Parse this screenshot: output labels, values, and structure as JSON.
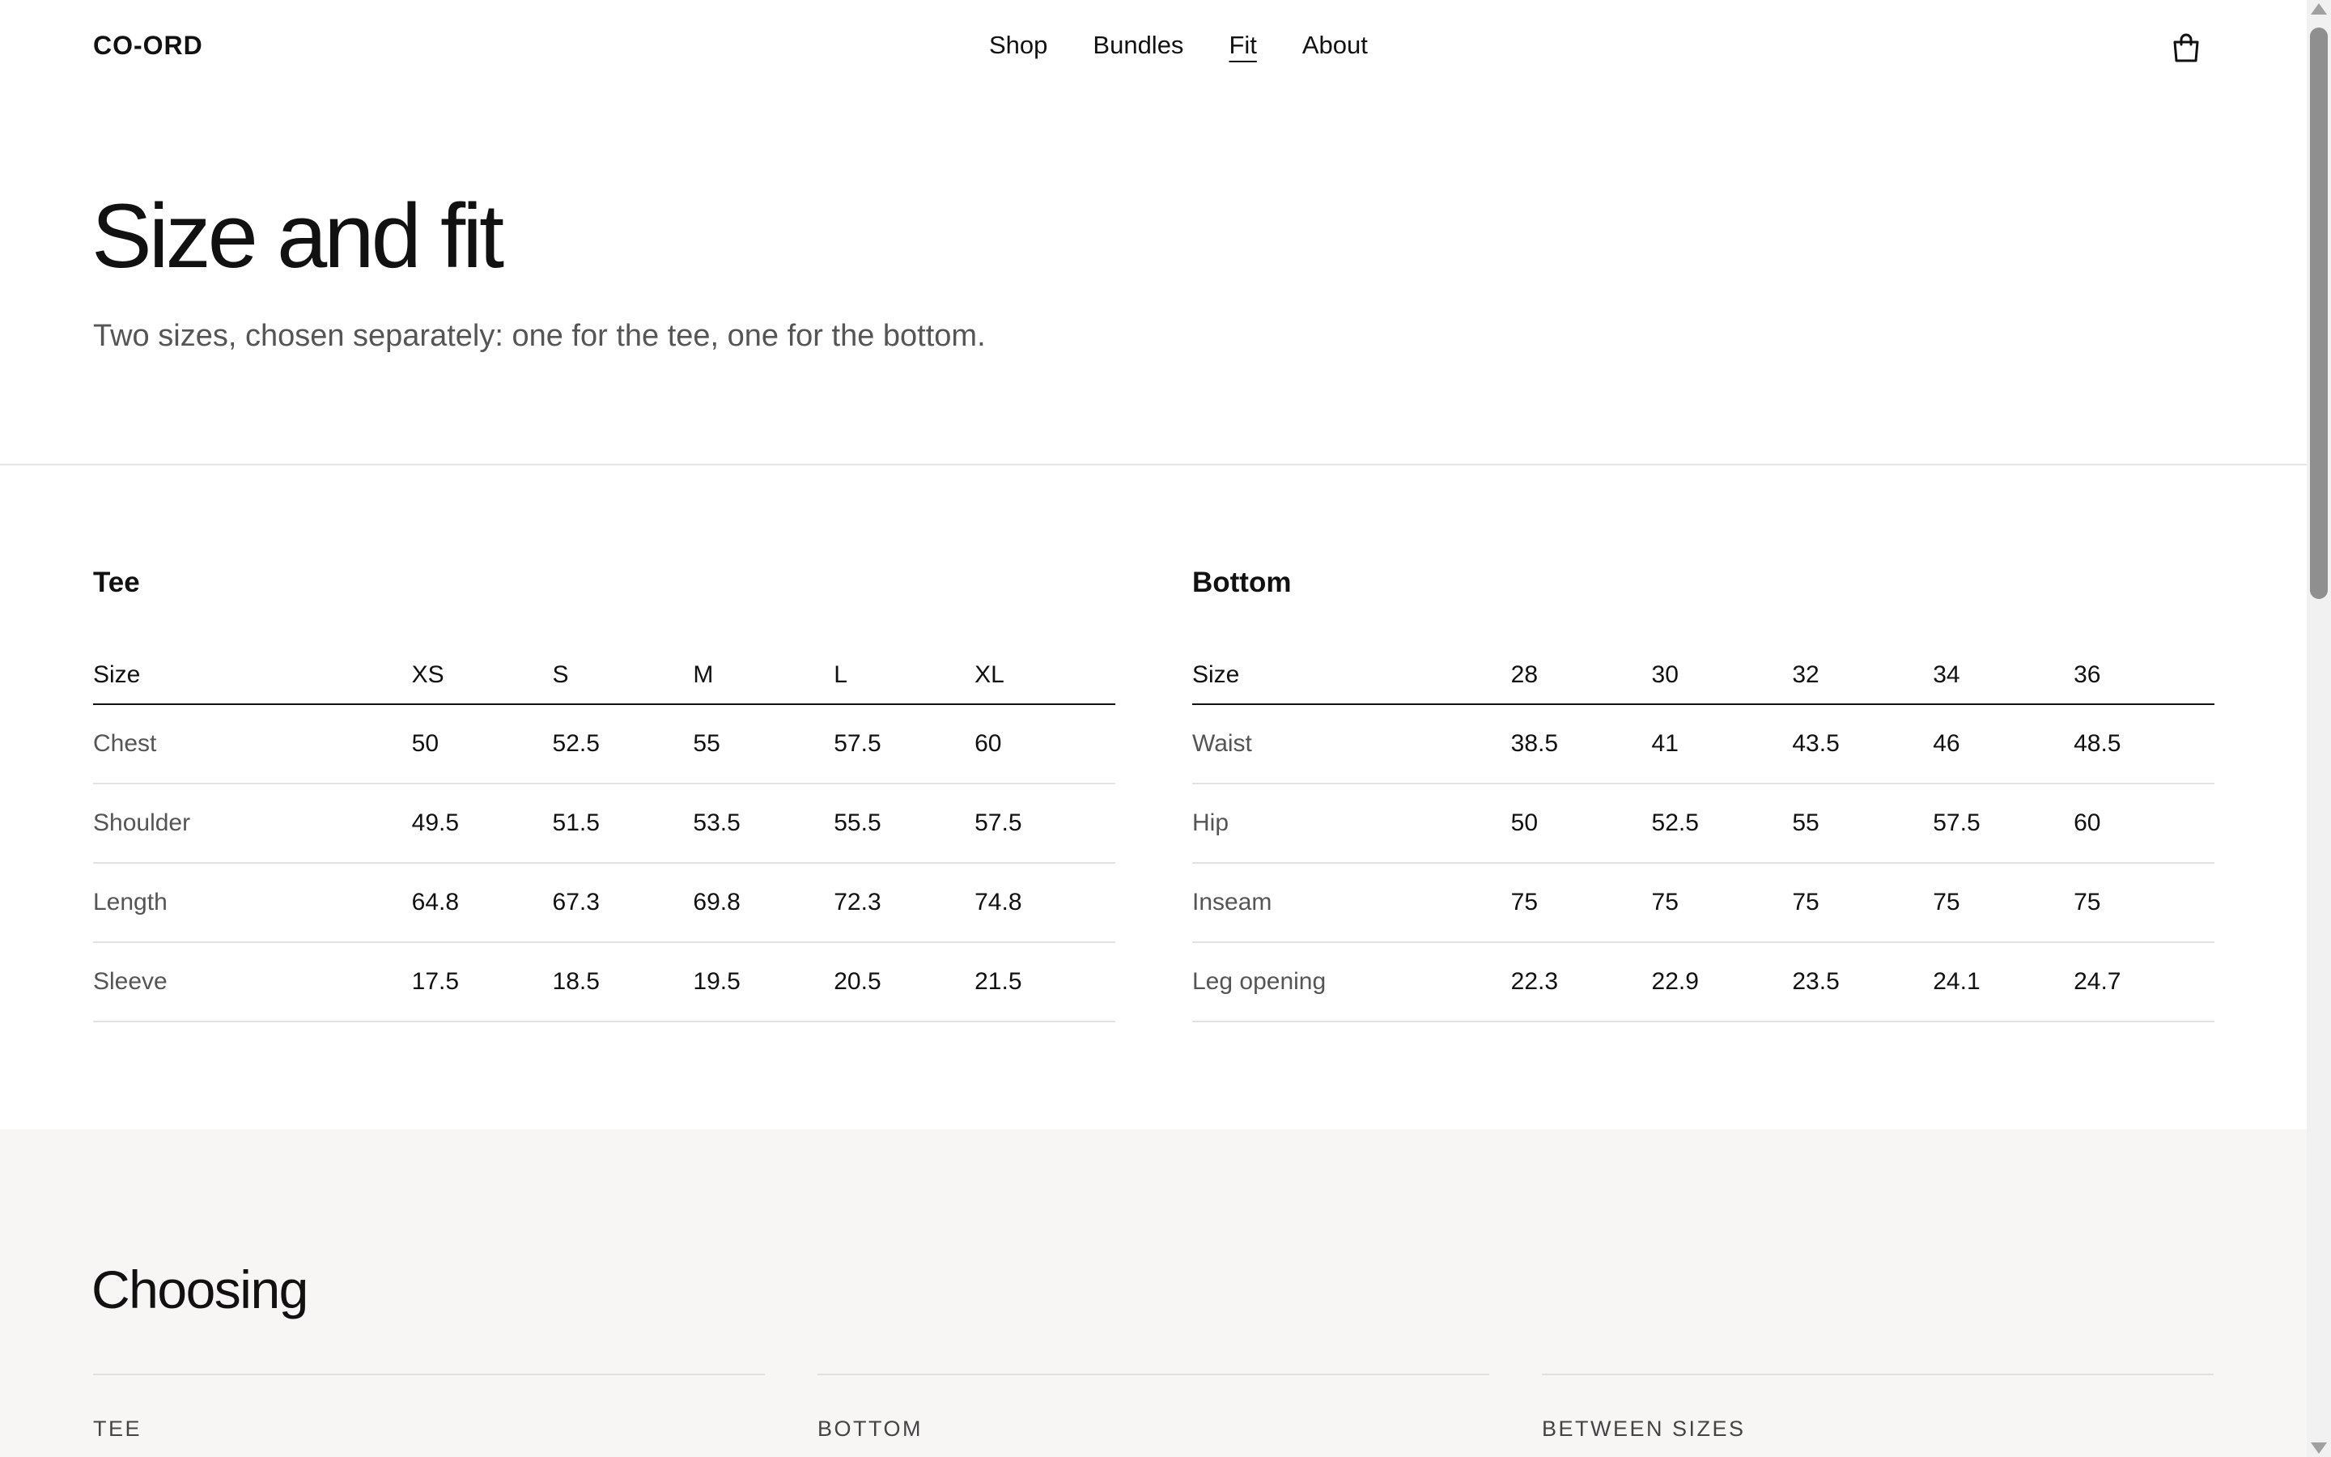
{
  "header": {
    "logo": "CO-ORD",
    "nav": [
      {
        "label": "Shop",
        "active": false
      },
      {
        "label": "Bundles",
        "active": false
      },
      {
        "label": "Fit",
        "active": true
      },
      {
        "label": "About",
        "active": false
      }
    ],
    "cart_icon": "shopping-bag-icon"
  },
  "hero": {
    "title": "Size and fit",
    "subtitle": "Two sizes, chosen separately: one for the tee, one for the bottom."
  },
  "tee": {
    "title": "Tee",
    "headers": [
      "Size",
      "XS",
      "S",
      "M",
      "L",
      "XL"
    ],
    "rows": [
      {
        "label": "Chest",
        "values": [
          "50",
          "52.5",
          "55",
          "57.5",
          "60"
        ]
      },
      {
        "label": "Shoulder",
        "values": [
          "49.5",
          "51.5",
          "53.5",
          "55.5",
          "57.5"
        ]
      },
      {
        "label": "Length",
        "values": [
          "64.8",
          "67.3",
          "69.8",
          "72.3",
          "74.8"
        ]
      },
      {
        "label": "Sleeve",
        "values": [
          "17.5",
          "18.5",
          "19.5",
          "20.5",
          "21.5"
        ]
      }
    ]
  },
  "bottom": {
    "title": "Bottom",
    "headers": [
      "Size",
      "28",
      "30",
      "32",
      "34",
      "36"
    ],
    "rows": [
      {
        "label": "Waist",
        "values": [
          "38.5",
          "41",
          "43.5",
          "46",
          "48.5"
        ]
      },
      {
        "label": "Hip",
        "values": [
          "50",
          "52.5",
          "55",
          "57.5",
          "60"
        ]
      },
      {
        "label": "Inseam",
        "values": [
          "75",
          "75",
          "75",
          "75",
          "75"
        ]
      },
      {
        "label": "Leg opening",
        "values": [
          "22.3",
          "22.9",
          "23.5",
          "24.1",
          "24.7"
        ]
      }
    ]
  },
  "choosing": {
    "title": "Choosing",
    "columns": [
      "TEE",
      "BOTTOM",
      "BETWEEN SIZES"
    ]
  },
  "colors": {
    "text": "#111111",
    "muted": "#555555",
    "section_bg": "#f7f6f4"
  }
}
